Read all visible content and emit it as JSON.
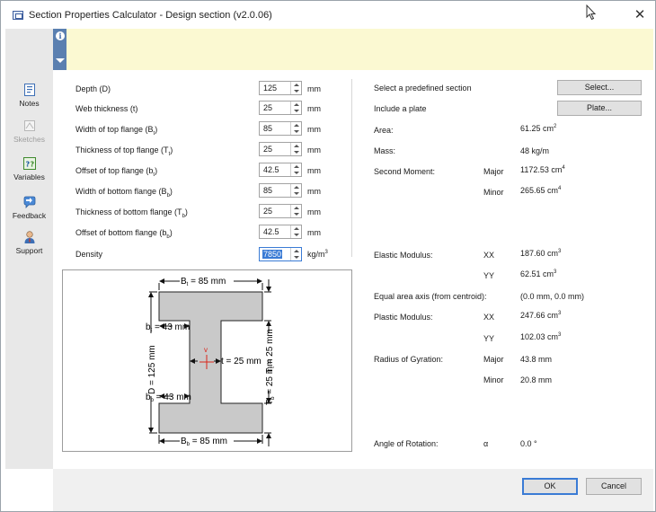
{
  "window": {
    "title": "Section Properties Calculator - Design section (v2.0.06)",
    "close_symbol": "✕"
  },
  "sidebar": {
    "items": [
      {
        "label": "Notes",
        "icon": "notes-icon",
        "enabled": true
      },
      {
        "label": "Sketches",
        "icon": "sketches-icon",
        "enabled": false
      },
      {
        "label": "Variables",
        "icon": "variables-icon",
        "enabled": true
      },
      {
        "label": "Feedback",
        "icon": "feedback-icon",
        "enabled": true
      },
      {
        "label": "Support",
        "icon": "support-icon",
        "enabled": true
      }
    ]
  },
  "inputs": [
    {
      "label": "Depth (D)",
      "value": "125",
      "unit": "mm"
    },
    {
      "label": "Web thickness (t)",
      "value": "25",
      "unit": "mm"
    },
    {
      "label": "Width of top flange (B",
      "sub": "t",
      "label_end": ")",
      "value": "85",
      "unit": "mm"
    },
    {
      "label": "Thickness of top flange (T",
      "sub": "t",
      "label_end": ")",
      "value": "25",
      "unit": "mm"
    },
    {
      "label": "Offset of top flange (b",
      "sub": "t",
      "label_end": ")",
      "value": "42.5",
      "unit": "mm"
    },
    {
      "label": "Width of bottom flange (B",
      "sub": "b",
      "label_end": ")",
      "value": "85",
      "unit": "mm"
    },
    {
      "label": "Thickness of bottom flange (T",
      "sub": "b",
      "label_end": ")",
      "value": "25",
      "unit": "mm"
    },
    {
      "label": "Offset of bottom flange (b",
      "sub": "b",
      "label_end": ")",
      "value": "42.5",
      "unit": "mm"
    },
    {
      "label": "Density",
      "value": "7850",
      "unit": "kg/m",
      "unit_sup": "3"
    }
  ],
  "predefined": {
    "label": "Select a predefined section",
    "button": "Select..."
  },
  "plate": {
    "label": "Include a plate",
    "button": "Plate..."
  },
  "results": {
    "area": {
      "label": "Area:",
      "value": "61.25 cm",
      "sup": "2"
    },
    "mass": {
      "label": "Mass:",
      "value": "48 kg/m"
    },
    "second_moment": {
      "label": "Second Moment:",
      "major_label": "Major",
      "major_value": "1172.53 cm",
      "major_sup": "4",
      "minor_label": "Minor",
      "minor_value": "265.65 cm",
      "minor_sup": "4"
    },
    "elastic_modulus": {
      "label": "Elastic Modulus:",
      "xx_label": "XX",
      "xx_value": "187.60 cm",
      "xx_sup": "3",
      "yy_label": "YY",
      "yy_value": "62.51 cm",
      "yy_sup": "3"
    },
    "equal_area": {
      "label": "Equal area axis (from centroid):",
      "value": "(0.0 mm, 0.0 mm)"
    },
    "plastic_modulus": {
      "label": "Plastic Modulus:",
      "xx_label": "XX",
      "xx_value": "247.66 cm",
      "xx_sup": "3",
      "yy_label": "YY",
      "yy_value": "102.03 cm",
      "yy_sup": "3"
    },
    "radius_gyration": {
      "label": "Radius of Gyration:",
      "major_label": "Major",
      "major_value": "43.8 mm",
      "minor_label": "Minor",
      "minor_value": "20.8 mm"
    },
    "rotation": {
      "label": "Angle of Rotation:",
      "symbol": "α",
      "value": "0.0 °"
    }
  },
  "diagram": {
    "top_width": "B",
    "top_width_sub": "t",
    "top_width_rest": " = 85 mm",
    "bottom_width": "B",
    "bottom_width_sub": "b",
    "bottom_width_rest": " = 85 mm",
    "top_offset": "b",
    "top_offset_sub": "t",
    "top_offset_rest": " = 43 mm",
    "bottom_offset": "b",
    "bottom_offset_sub": "b",
    "bottom_offset_rest": " = 43 mm",
    "depth": "D = 125 mm",
    "web": "t = 25 mm",
    "top_thk": "T",
    "top_thk_sub": "t",
    "top_thk_rest": " = 25 mm",
    "bottom_thk": "T",
    "bottom_thk_sub": "b",
    "bottom_thk_rest": " = 25 mm",
    "v_axis": "v",
    "section_fill": "#c9c9c9",
    "centroid_color": "#d9261c"
  },
  "footer": {
    "ok": "OK",
    "cancel": "Cancel"
  },
  "colors": {
    "banner": "#fbf9d2",
    "info_strip": "#5a7fb0",
    "sidebar": "#e8e8e8",
    "accent": "#3a7bd5"
  }
}
